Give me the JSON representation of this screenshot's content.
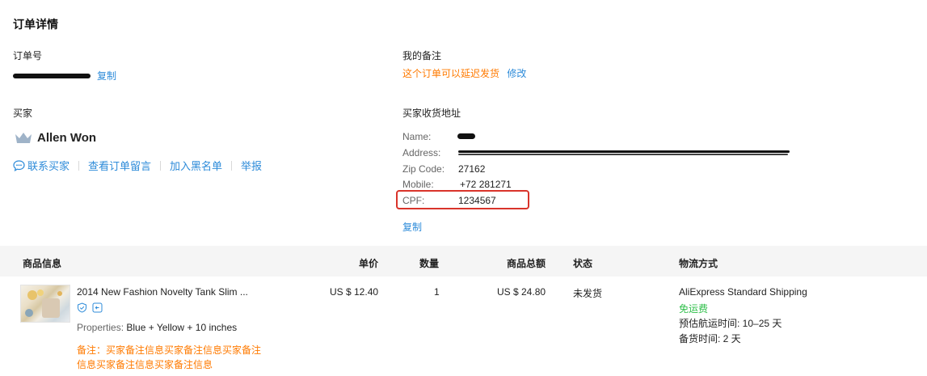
{
  "page": {
    "title": "订单详情"
  },
  "order": {
    "label": "订单号",
    "copy_label": "复制"
  },
  "remark": {
    "label": "我的备注",
    "text": "这个订单可以延迟发货",
    "edit_label": "修改"
  },
  "buyer": {
    "label": "买家",
    "name": "Allen Won",
    "actions": [
      "联系买家",
      "查看订单留言",
      "加入黑名单",
      "举报"
    ],
    "icons": {
      "crown": "crown-icon",
      "chat": "chat-bubble-icon"
    }
  },
  "address": {
    "label": "买家收货地址",
    "name_label": "Name:",
    "address_label": "Address:",
    "zip_label": "Zip Code:",
    "zip_value": "27162",
    "mobile_label": "Mobile:",
    "mobile_value": "+72 281271",
    "cpf_label": "CPF:",
    "cpf_value": "1234567",
    "copy_label": "复制"
  },
  "table": {
    "headers": [
      "商品信息",
      "单价",
      "数量",
      "商品总额",
      "状态",
      "物流方式"
    ],
    "row": {
      "product_title": "2014 New Fashion Novelty Tank Slim ...",
      "properties_label": "Properties:",
      "properties_value": "Blue + Yellow + 10 inches",
      "note_line1": "备注：买家备注信息买家备注信息买家备注",
      "note_line2": "信息买家备注信息买家备注信息",
      "unit_price": "US $ 12.40",
      "quantity": "1",
      "total": "US $ 24.80",
      "status": "未发货",
      "shipping_method": "AliExpress Standard Shipping",
      "shipping_fee": "免运费",
      "eta": "预估航运时间: 10–25 天",
      "prep": "备货时间: 2 天",
      "icons": [
        "shield-check-icon",
        "return-icon"
      ]
    }
  },
  "colors": {
    "link": "#2d8bd9",
    "note": "#ff7a00",
    "free_shipping": "#2fbf4a",
    "highlight_box": "#d9342b",
    "header_bg": "#f5f5f5"
  }
}
